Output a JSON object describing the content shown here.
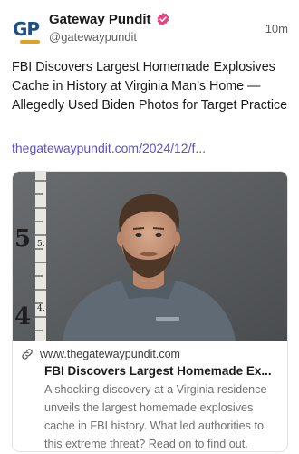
{
  "post": {
    "author": {
      "display_name": "Gateway Pundit",
      "handle": "@gatewaypundit",
      "avatar_text": "GP",
      "verified": true
    },
    "timestamp": "10m",
    "text": "FBI Discovers Largest Homemade Explosives Cache in History at Virginia Man’s Home — Allegedly Used Biden Photos for Target Practice",
    "link": "thegatewaypundit.com/2024/12/f..."
  },
  "card": {
    "image_markings": [
      "5",
      "5.",
      "4",
      "4."
    ],
    "domain": "www.thegatewaypundit.com",
    "title": "FBI Discovers Largest Homemade Ex...",
    "description": "A shocking discovery at a Virginia residence unveils the largest homemade explosives cache in FBI history. What led authorities to this extreme threat? Read on to find out."
  },
  "colors": {
    "link": "#5b4fd6",
    "verified_badge": "#e8417f",
    "brand_blue": "#1f4e8c",
    "brand_gold": "#e0a321"
  },
  "icons": {
    "verified": "verified-badge-icon",
    "link": "link-chain-icon"
  }
}
